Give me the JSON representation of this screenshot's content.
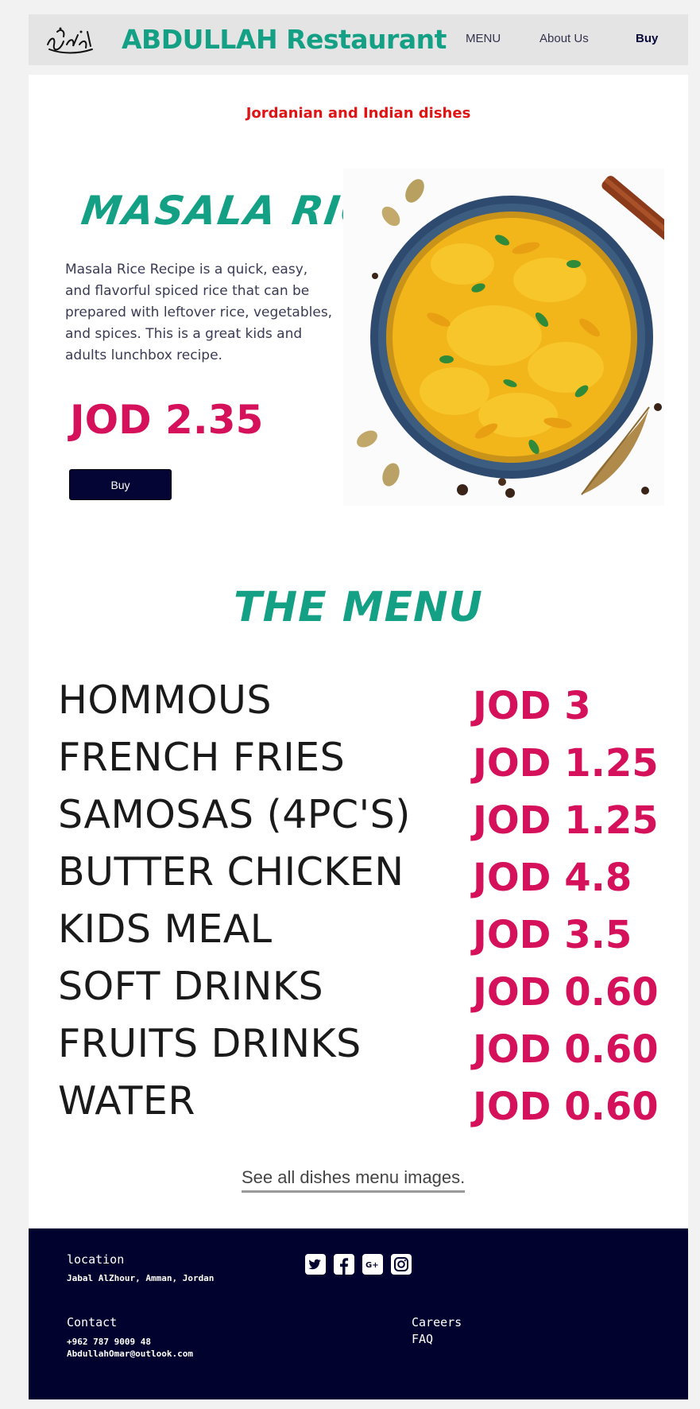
{
  "nav": {
    "brand": "ABDULLAH Restaurant",
    "menu_label": "MENU",
    "about_label": "About Us",
    "buy_label": "Buy"
  },
  "hero": {
    "subtitle": "Jordanian and Indian dishes",
    "dish_name": "MASALA RICE",
    "dish_description": "Masala Rice Recipe is a quick, easy, and flavorful spiced rice that can be prepared with leftover rice, vegetables, and spices. This is a great kids and adults lunchbox recipe.",
    "dish_price": "JOD 2.35",
    "buy_label": "Buy"
  },
  "menu": {
    "heading": "THE MENU",
    "items": [
      {
        "name": "HOMMOUS",
        "price": "JOD 3"
      },
      {
        "name": "FRENCH FRIES",
        "price": "JOD 1.25"
      },
      {
        "name": "SAMOSAS (4PC'S)",
        "price": "JOD 1.25"
      },
      {
        "name": "BUTTER CHICKEN",
        "price": "JOD 4.8"
      },
      {
        "name": "KIDS MEAL",
        "price": "JOD 3.5"
      },
      {
        "name": "SOFT DRINKS",
        "price": "JOD 0.60"
      },
      {
        "name": "FRUITS DRINKS",
        "price": "JOD 0.60"
      },
      {
        "name": "WATER",
        "price": "JOD 0.60"
      }
    ],
    "see_all_label": "See all dishes menu images."
  },
  "footer": {
    "location_heading": "location",
    "location_value": "Jabal AlZhour, Amman, Jordan",
    "contact_heading": "Contact",
    "phone": "+962 787 9009 48",
    "email": "AbdullahOmar@outlook.com",
    "careers_label": "Careers",
    "faq_label": "FAQ",
    "social_icons": [
      "twitter-icon",
      "facebook-icon",
      "google-plus-icon",
      "instagram-icon"
    ]
  },
  "colors": {
    "brand_green": "#14a085",
    "price_pink": "#d4115a",
    "subtitle_red": "#e01414",
    "navy": "#02022f"
  }
}
